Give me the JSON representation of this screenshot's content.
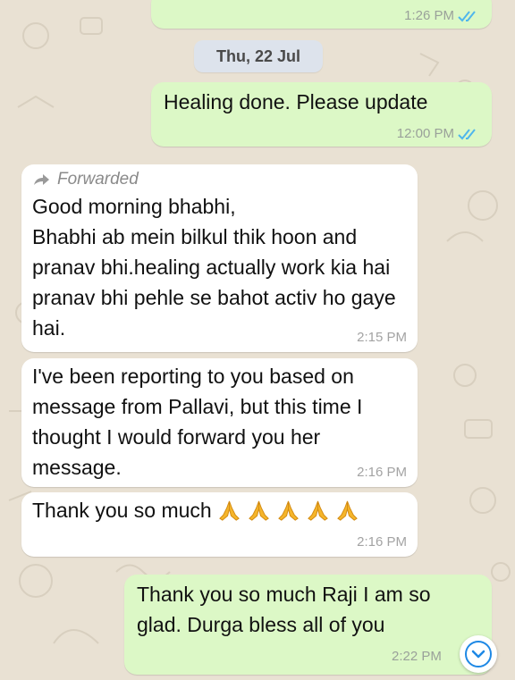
{
  "chat": {
    "date_separator": "Thu, 22 Jul",
    "messages": [
      {
        "direction": "out",
        "text": "",
        "time": "1:26 PM",
        "read": true
      },
      {
        "direction": "out",
        "text": "Healing done. Please update",
        "time": "12:00 PM",
        "read": true
      },
      {
        "direction": "in",
        "forwarded": true,
        "forwarded_label": "Forwarded",
        "text": "Good morning bhabhi,\nBhabhi ab mein bilkul thik hoon and pranav bhi.healing actually work kia hai pranav bhi pehle se bahot activ ho gaye hai.",
        "time": "2:15 PM"
      },
      {
        "direction": "in",
        "text": "I've been reporting to you based on message from Pallavi, but this time I thought I would forward you her message.",
        "time": "2:16 PM"
      },
      {
        "direction": "in",
        "text": "Thank you so much",
        "emoji": "folded-hands x5",
        "time": "2:16 PM"
      },
      {
        "direction": "out",
        "text": "Thank you so much Raji I am so glad. Durga bless all of you",
        "time": "2:22 PM",
        "read": false
      }
    ]
  },
  "icons": {
    "read_ticks": "double-check-icon",
    "forward": "forward-arrow-icon",
    "scroll_down": "chevron-down-icon",
    "emoji": "folded-hands-icon"
  },
  "colors": {
    "background": "#e9e1d3",
    "outgoing_bubble": "#dcf8c6",
    "incoming_bubble": "#ffffff",
    "read_ticks": "#4fb6ec",
    "scroll_button_chevron": "#1e88e5"
  }
}
